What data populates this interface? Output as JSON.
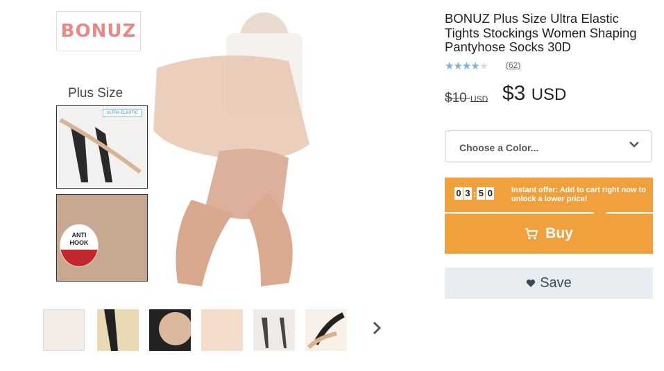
{
  "gallery": {
    "brand_logo_text": "BONUZ",
    "plus_size_label": "Plus Size",
    "inset_badge": "ULTRA ELASTIC",
    "anti_hook_line1": "ANTI",
    "anti_hook_line2": "HOOK",
    "thumbnails": [
      {
        "name": "thumb-1",
        "active": true
      },
      {
        "name": "thumb-2",
        "active": false
      },
      {
        "name": "thumb-3",
        "active": false
      },
      {
        "name": "thumb-4",
        "active": false
      },
      {
        "name": "thumb-5",
        "active": false
      },
      {
        "name": "thumb-6",
        "active": false
      }
    ],
    "next_icon": "chevron-right-icon"
  },
  "product": {
    "title": "BONUZ Plus Size Ultra Elastic Tights Stockings Women Shaping Pantyhose Socks 30D",
    "rating": 4,
    "rating_max": 5,
    "review_count": "(62)",
    "old_price": "$10",
    "old_price_currency": "USD",
    "new_price": "$3",
    "new_price_currency": "USD"
  },
  "color_select": {
    "label": "Choose a Color...",
    "icon": "chevron-down-icon"
  },
  "offer": {
    "timer_digits": [
      "0",
      "3",
      "5",
      "0"
    ],
    "text": "Instant offer: Add to cart right now to unlock a lower price!"
  },
  "buy_button": {
    "label": "Buy",
    "icon": "cart-icon"
  },
  "save_button": {
    "label": "Save",
    "icon": "heart-icon"
  },
  "colors": {
    "accent_orange": "#f0a03c",
    "star_blue": "#7bb3de",
    "save_bg": "#e7edf1"
  }
}
